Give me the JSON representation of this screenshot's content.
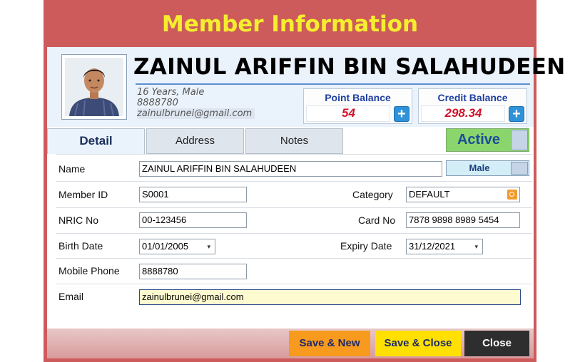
{
  "window": {
    "title": "Member Information"
  },
  "member": {
    "name": "ZAINUL ARIFFIN BIN SALAHUDEEN",
    "age_gender": "16 Years, Male",
    "phone": "8888780",
    "email": "zainulbrunei@gmail.com"
  },
  "balances": {
    "point_label": "Point Balance",
    "point_value": "54",
    "credit_label": "Credit Balance",
    "credit_value": "298.34",
    "add_icon": "+"
  },
  "tabs": [
    {
      "label": "Detail",
      "active": true
    },
    {
      "label": "Address",
      "active": false
    },
    {
      "label": "Notes",
      "active": false
    }
  ],
  "status_toggle": {
    "label": "Active"
  },
  "form": {
    "name_label": "Name",
    "name_value": "ZAINUL ARIFFIN BIN SALAHUDEEN",
    "gender_value": "Male",
    "member_id_label": "Member ID",
    "member_id_value": "S0001",
    "category_label": "Category",
    "category_value": "DEFAULT",
    "nric_label": "NRIC No",
    "nric_value": "00-123456",
    "card_label": "Card No",
    "card_value": "7878 9898 8989 5454",
    "birth_label": "Birth Date",
    "birth_value": "01/01/2005",
    "expiry_label": "Expiry Date",
    "expiry_value": "31/12/2021",
    "mobile_label": "Mobile Phone",
    "mobile_value": "8888780",
    "email_label": "Email",
    "email_value": "zainulbrunei@gmail.com"
  },
  "buttons": {
    "save_new": "Save & New",
    "save_close": "Save & Close",
    "close": "Close"
  },
  "colors": {
    "window_bg": "#cd5b5b",
    "title_yellow": "#f5ee2f",
    "active_green": "#8bd56d",
    "save_new_bg": "#f79a1e",
    "save_close_bg": "#ffe000",
    "close_bg": "#2e2e2e"
  },
  "icons": {
    "dropdown": "▾",
    "category_search": "search-icon"
  }
}
